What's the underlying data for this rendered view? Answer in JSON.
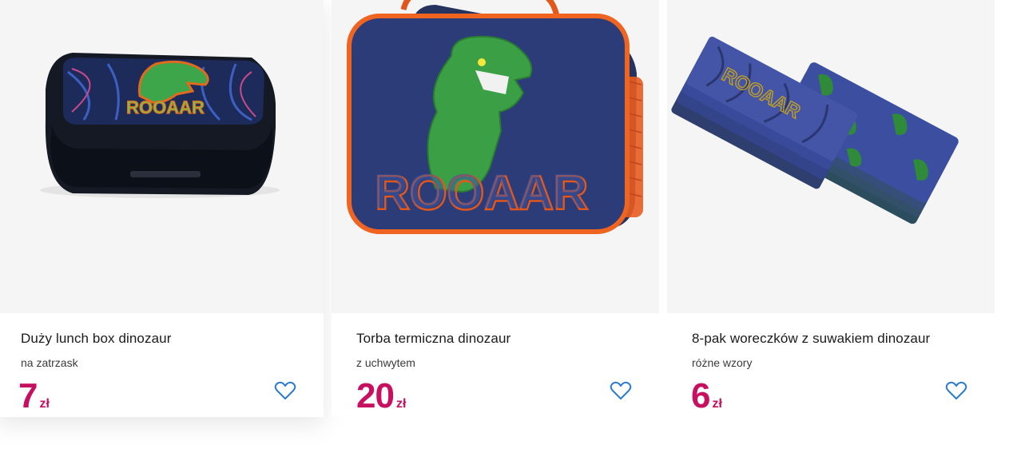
{
  "products": [
    {
      "name": "Duży lunch box dinozaur",
      "subtitle": "na zatrzask",
      "price": "7",
      "currency": "zł",
      "image_text": "ROOAAR",
      "favorite_icon": "heart-outline-icon"
    },
    {
      "name": "Torba termiczna dinozaur",
      "subtitle": "z uchwytem",
      "price": "20",
      "currency": "zł",
      "image_text": "ROOAAR",
      "favorite_icon": "heart-outline-icon"
    },
    {
      "name": "8-pak woreczków z suwakiem dinozaur",
      "subtitle": "różne wzory",
      "price": "6",
      "currency": "zł",
      "image_text": "ROOAAR",
      "favorite_icon": "heart-outline-icon"
    }
  ],
  "colors": {
    "price": "#c7105f",
    "heart": "#2a7ad0",
    "image_bg": "#f5f5f5"
  }
}
